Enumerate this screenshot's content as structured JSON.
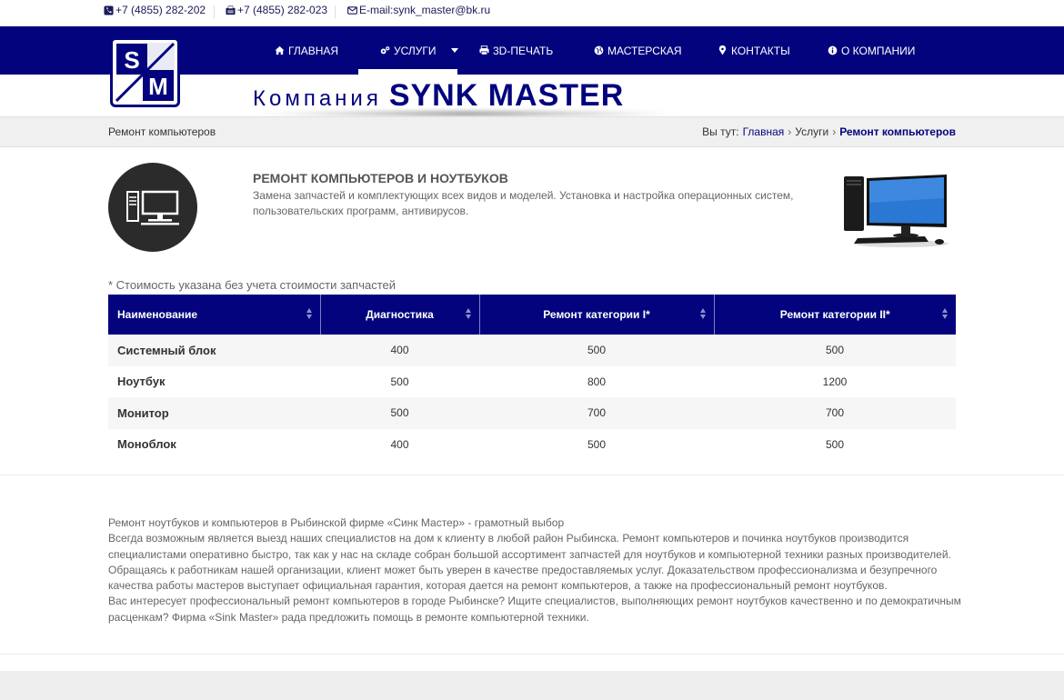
{
  "topbar": {
    "phone1": "+7 (4855) 282-202",
    "phone2": "+7 (4855) 282-023",
    "email": "E-mail:synk_master@bk.ru"
  },
  "nav": {
    "items": [
      {
        "label": "ГЛАВНАЯ",
        "icon": "home-icon"
      },
      {
        "label": "УСЛУГИ",
        "icon": "gears-icon",
        "active": true,
        "has_dropdown": true
      },
      {
        "label": "3D-ПЕЧАТЬ",
        "icon": "print-icon"
      },
      {
        "label": "МАСТЕРСКАЯ",
        "icon": "globe-icon"
      },
      {
        "label": "КОНТАКТЫ",
        "icon": "map-marker-icon"
      },
      {
        "label": "О КОМПАНИИ",
        "icon": "info-icon"
      }
    ]
  },
  "brand": {
    "logo_letters": [
      "S",
      "M"
    ],
    "prefix": "Компания",
    "name": "SYNK MASTER"
  },
  "breadcrumbs": {
    "page_title": "Ремонт компьютеров",
    "prefix": "Вы тут:",
    "items": [
      "Главная",
      "Услуги",
      "Ремонт компьютеров"
    ]
  },
  "service": {
    "title": "РЕМОНТ КОМПЬЮТЕРОВ И НОУТБУКОВ",
    "description": "Замена запчастей и комплектующих всех видов и моделей. Установка и настройка операционных систем, пользовательских программ, антивирусов."
  },
  "price_note": "* Стоимость указана без учета стоимости запчастей",
  "price_table": {
    "headers": [
      "Наименование",
      "Диагностика",
      "Ремонт категории I*",
      "Ремонт категории II*"
    ],
    "rows": [
      [
        "Системный блок",
        "400",
        "500",
        "500"
      ],
      [
        "Ноутбук",
        "500",
        "800",
        "1200"
      ],
      [
        "Монитор",
        "500",
        "700",
        "700"
      ],
      [
        "Моноблок",
        "400",
        "500",
        "500"
      ]
    ]
  },
  "article": {
    "lines": [
      "Ремонт ноутбуков и компьютеров в Рыбинской фирме «Синк Мастер» - грамотный выбор",
      "Всегда возможным является выезд наших специалистов на дом к клиенту в любой район Рыбинска. Ремонт компьютеров и починка ноутбуков производится специалистами оперативно быстро, так как у нас на складе собран большой ассортимент запчастей для ноутбуков и компьютерной техники разных производителей.",
      "Обращаясь к работникам нашей организации, клиент может быть уверен в качестве предоставляемых услуг. Доказательством профессионализма и безупречного качества работы мастеров выступает официальная гарантия, которая дается на ремонт компьютеров, а также на профессиональный ремонт ноутбуков.",
      "Вас интересует профессиональный ремонт компьютеров в городе Рыбинске? Ищите специалистов, выполняющих ремонт ноутбуков качественно и по демократичным расценкам? Фирма «Sink Master» рада предложить помощь в ремонте компьютерной техники."
    ]
  },
  "colors": {
    "brand_navy": "#03047d",
    "circle_dark": "#2b2b2b"
  }
}
